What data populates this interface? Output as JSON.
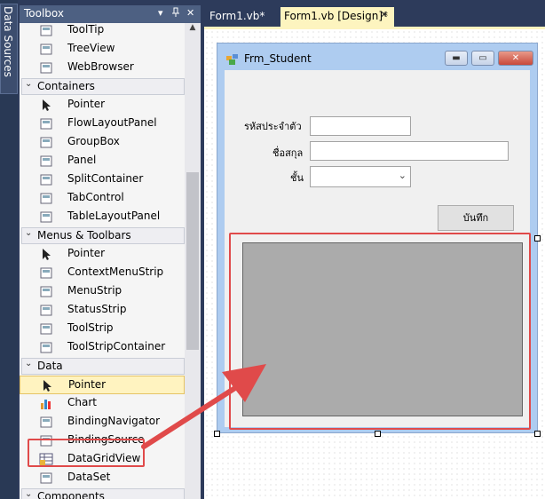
{
  "data_sources_tab": {
    "label": "Data Sources"
  },
  "toolbox": {
    "title": "Toolbox",
    "dropdown_glyph": "▾",
    "pin_glyph": "  ",
    "close_glyph": "✕",
    "rows": [
      {
        "kind": "item",
        "label": "ToolTip",
        "icon": "tooltip-icon"
      },
      {
        "kind": "item",
        "label": "TreeView",
        "icon": "treeview-icon"
      },
      {
        "kind": "item",
        "label": "WebBrowser",
        "icon": "webbrowser-icon"
      },
      {
        "kind": "group",
        "label": "Containers"
      },
      {
        "kind": "item",
        "label": "Pointer",
        "icon": "pointer-icon"
      },
      {
        "kind": "item",
        "label": "FlowLayoutPanel",
        "icon": "flowlayoutpanel-icon"
      },
      {
        "kind": "item",
        "label": "GroupBox",
        "icon": "groupbox-icon"
      },
      {
        "kind": "item",
        "label": "Panel",
        "icon": "panel-icon"
      },
      {
        "kind": "item",
        "label": "SplitContainer",
        "icon": "splitcontainer-icon"
      },
      {
        "kind": "item",
        "label": "TabControl",
        "icon": "tabcontrol-icon"
      },
      {
        "kind": "item",
        "label": "TableLayoutPanel",
        "icon": "tablelayoutpanel-icon"
      },
      {
        "kind": "group",
        "label": "Menus & Toolbars"
      },
      {
        "kind": "item",
        "label": "Pointer",
        "icon": "pointer-icon"
      },
      {
        "kind": "item",
        "label": "ContextMenuStrip",
        "icon": "contextmenustrip-icon"
      },
      {
        "kind": "item",
        "label": "MenuStrip",
        "icon": "menustrip-icon"
      },
      {
        "kind": "item",
        "label": "StatusStrip",
        "icon": "statusstrip-icon"
      },
      {
        "kind": "item",
        "label": "ToolStrip",
        "icon": "toolstrip-icon"
      },
      {
        "kind": "item",
        "label": "ToolStripContainer",
        "icon": "toolstripcontainer-icon"
      },
      {
        "kind": "group",
        "label": "Data"
      },
      {
        "kind": "item",
        "label": "Pointer",
        "icon": "pointer-icon",
        "selected": true
      },
      {
        "kind": "item",
        "label": "Chart",
        "icon": "chart-icon"
      },
      {
        "kind": "item",
        "label": "BindingNavigator",
        "icon": "bindingnavigator-icon"
      },
      {
        "kind": "item",
        "label": "BindingSource",
        "icon": "bindingsource-icon"
      },
      {
        "kind": "item",
        "label": "DataGridView",
        "icon": "datagridview-icon"
      },
      {
        "kind": "item",
        "label": "DataSet",
        "icon": "dataset-icon"
      },
      {
        "kind": "group",
        "label": "Components"
      }
    ]
  },
  "tabs": [
    {
      "label": "Form1.vb*"
    },
    {
      "label": "Form1.vb [Design]*"
    }
  ],
  "form": {
    "title": "Frm_Student",
    "labels": {
      "student_id": "รหัสประจำตัว",
      "full_name": "ชื่อสกุล",
      "class_level": "ชั้น"
    },
    "save_button": "บันทึก"
  },
  "colors": {
    "highlight": "#e04a4a",
    "selected_row": "#fff3c0",
    "accent_title": "#4d6082"
  }
}
